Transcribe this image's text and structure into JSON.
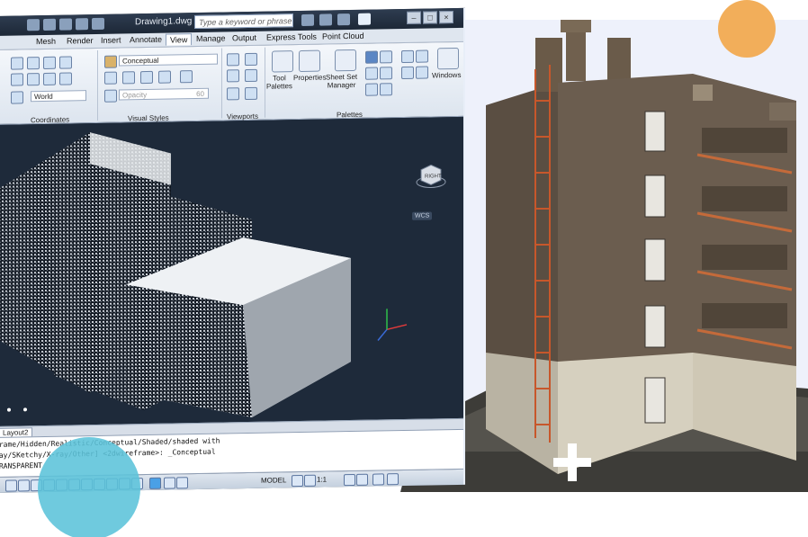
{
  "cad": {
    "document_title": "Drawing1.dwg",
    "search_placeholder": "Type a keyword or phrase",
    "menu": [
      "Mesh",
      "Render",
      "Insert",
      "Annotate",
      "View",
      "Manage",
      "Output",
      "Express Tools",
      "Point Cloud"
    ],
    "active_menu": "View",
    "ribbon": {
      "visual_style": "Conceptual",
      "ucs": "World",
      "opacity_label": "Opacity",
      "opacity_value": "60",
      "buttons": {
        "tool_palettes": "Tool\nPalettes",
        "properties": "Properties",
        "sheet_set_manager": "Sheet Set\nManager",
        "windows": "Windows"
      },
      "panels": [
        "Coordinates",
        "Visual Styles",
        "Viewports",
        "Palettes"
      ]
    },
    "viewcube_label": "RIGHT",
    "wcs_label": "WCS",
    "layout_tab": "Layout2",
    "command_lines": [
      "frame/Hidden/Realistic/Conceptual/Shaded/shaded with",
      "ray/SKetchy/X-ray/Other] <2dwireframe>: _Conceptual",
      "TRANSPARENT"
    ],
    "status": {
      "model": "MODEL",
      "scale": "1:1"
    }
  },
  "colors": {
    "orange_dot": "#f2ae5a",
    "teal_dot": "#5bc3da",
    "panel_bg": "#eef1fb",
    "viewport_bg": "#1e2a3a"
  }
}
